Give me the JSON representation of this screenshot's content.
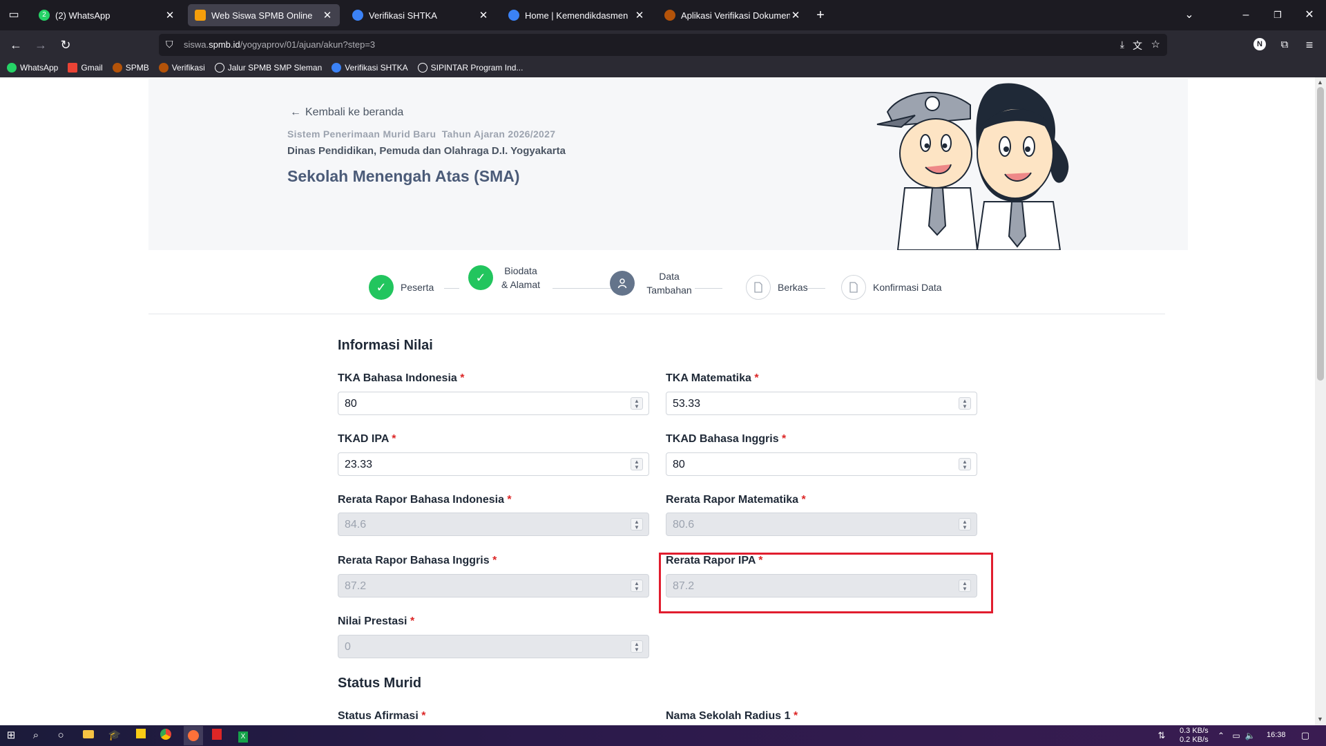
{
  "browser": {
    "tabs": [
      {
        "title": "(2) WhatsApp",
        "favicon_color": "#25d366",
        "badge": "2",
        "active": false
      },
      {
        "title": "Web Siswa SPMB Online",
        "favicon_color": "#f59e0b",
        "active": true
      },
      {
        "title": "Verifikasi SHTKA",
        "favicon_color": "#3b82f6",
        "active": false
      },
      {
        "title": "Home | Kemendikdasmen",
        "favicon_color": "#3b82f6",
        "active": false
      },
      {
        "title": "Aplikasi Verifikasi Dokumen dan",
        "favicon_color": "#b45309",
        "active": false
      }
    ],
    "url_prefix": "siswa.",
    "url_domain": "spmb.id",
    "url_path": "/yogyaprov/01/ajuan/akun?step=3",
    "profile_initial": "N",
    "bookmarks": [
      {
        "label": "WhatsApp",
        "color": "#25d366"
      },
      {
        "label": "Gmail",
        "color": "#ea4335"
      },
      {
        "label": "SPMB",
        "color": "#b45309"
      },
      {
        "label": "Verifikasi",
        "color": "#b45309"
      },
      {
        "label": "Jalur SPMB SMP Sleman",
        "color": "#9ca3af"
      },
      {
        "label": "Verifikasi SHTKA",
        "color": "#3b82f6"
      },
      {
        "label": "SIPINTAR Program Ind...",
        "color": "#9ca3af"
      }
    ]
  },
  "header": {
    "back_link": "Kembali ke beranda",
    "system_name": "Sistem Penerimaan Murid Baru  Tahun Ajaran 2026/2027",
    "agency": "Dinas Pendidikan, Pemuda dan Olahraga D.I. Yogyakarta",
    "school_level": "Sekolah Menengah Atas (SMA)"
  },
  "steps": [
    {
      "label": "Peserta",
      "status": "done"
    },
    {
      "label": "Biodata & Alamat",
      "status": "done"
    },
    {
      "label": "Data Tambahan",
      "status": "current"
    },
    {
      "label": "Berkas",
      "status": "pending"
    },
    {
      "label": "Konfirmasi Data",
      "status": "pending"
    }
  ],
  "nilai": {
    "title": "Informasi Nilai",
    "fields": [
      {
        "label": "TKA Bahasa Indonesia",
        "value": "80",
        "disabled": false
      },
      {
        "label": "TKA Matematika",
        "value": "53.33",
        "disabled": false
      },
      {
        "label": "TKAD IPA",
        "value": "23.33",
        "disabled": false
      },
      {
        "label": "TKAD Bahasa Inggris",
        "value": "80",
        "disabled": false
      },
      {
        "label": "Rerata Rapor Bahasa Indonesia",
        "value": "84.6",
        "disabled": true
      },
      {
        "label": "Rerata Rapor Matematika",
        "value": "80.6",
        "disabled": true
      },
      {
        "label": "Rerata Rapor Bahasa Inggris",
        "value": "87.2",
        "disabled": true
      },
      {
        "label": "Rerata Rapor IPA",
        "value": "87.2",
        "disabled": true
      },
      {
        "label": "Nilai Prestasi",
        "value": "0",
        "disabled": true
      }
    ]
  },
  "status_murid": {
    "title": "Status Murid",
    "afirmasi_label": "Status Afirmasi",
    "radius_label": "Nama Sekolah Radius 1"
  },
  "taskbar": {
    "net_down": "0.3 KB/s",
    "net_up": "0.2 KB/s",
    "time": "16:38"
  }
}
